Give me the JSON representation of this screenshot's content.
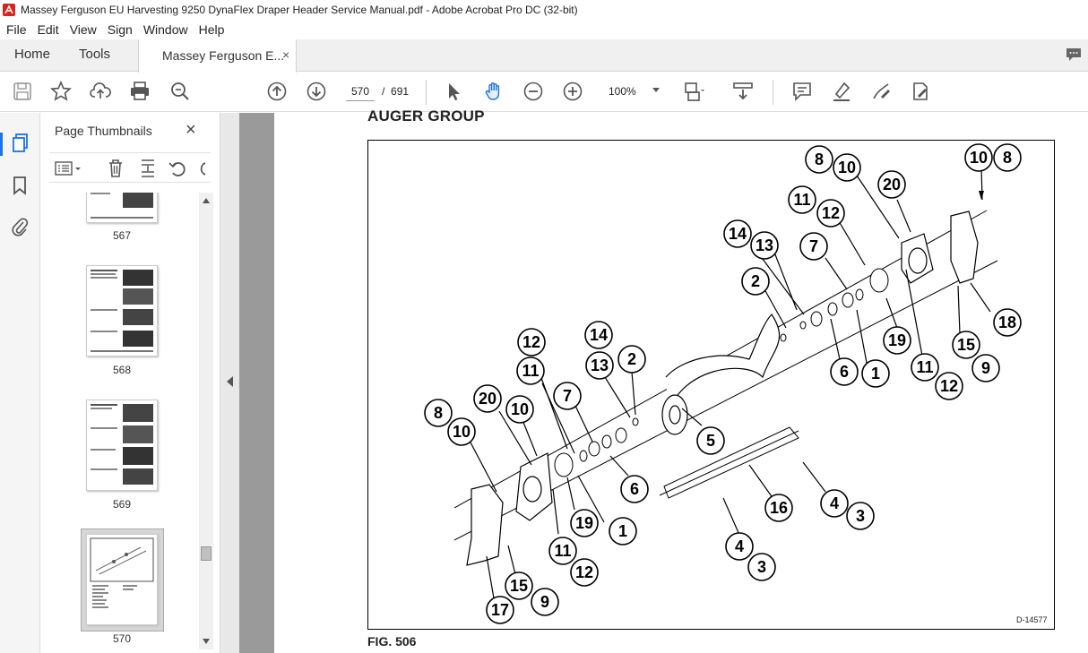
{
  "window": {
    "title": "Massey Ferguson EU Harvesting 9250 DynaFlex Draper Header Service Manual.pdf - Adobe Acrobat Pro DC (32-bit)"
  },
  "menu": [
    "File",
    "Edit",
    "View",
    "Sign",
    "Window",
    "Help"
  ],
  "tabs": {
    "home": "Home",
    "tools": "Tools",
    "document": "Massey Ferguson E...",
    "close": "×"
  },
  "toolbar": {
    "current_page": "570",
    "page_separator": "/",
    "total_pages": "691",
    "zoom": "100%"
  },
  "panel": {
    "title": "Page Thumbnails",
    "close": "×",
    "thumbnails": [
      {
        "label": "567"
      },
      {
        "label": "568"
      },
      {
        "label": "569"
      },
      {
        "label": "570",
        "selected": true
      }
    ]
  },
  "document": {
    "heading": "AUGER GROUP",
    "figure_caption": "FIG. 506",
    "figure_code": "D-14577",
    "callouts": [
      "8",
      "10",
      "20",
      "10",
      "8",
      "11",
      "12",
      "14",
      "13",
      "7",
      "2",
      "19",
      "1",
      "6",
      "11",
      "12",
      "18",
      "15",
      "9",
      "12",
      "11",
      "14",
      "13",
      "2",
      "7",
      "20",
      "10",
      "8",
      "10",
      "5",
      "6",
      "19",
      "1",
      "4",
      "3",
      "16",
      "11",
      "12",
      "4",
      "3",
      "15",
      "9",
      "17"
    ]
  },
  "colors": {
    "accent": "#1a73e8",
    "doc_background": "#9a9a9a",
    "acrobat_red": "#d9231c"
  }
}
